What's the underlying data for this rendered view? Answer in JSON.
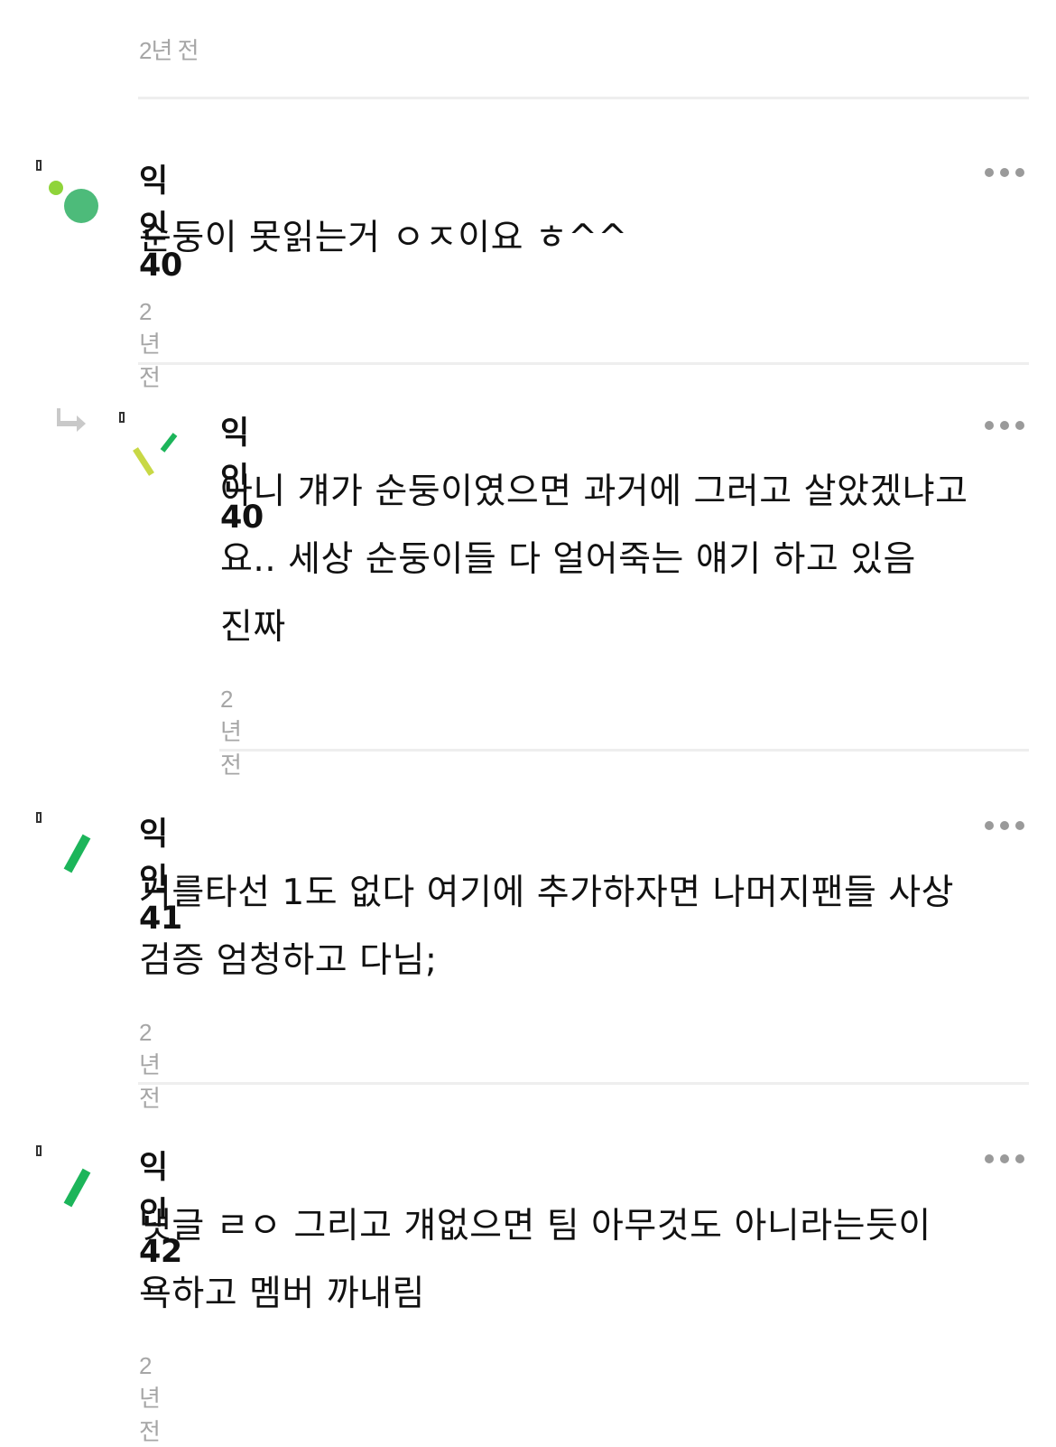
{
  "top": {
    "timestamp": "2년 전"
  },
  "comments": [
    {
      "author": "익인40",
      "text": "순둥이 못읽는거 ㅇㅈ이요 ㅎ^^",
      "timestamp": "2년 전",
      "avatar": "two-green-dots"
    },
    {
      "author": "익인40",
      "text": "아니 걔가 순둥이였으면 과거에 그러고 살았겠냐고요.. 세상 순둥이들 다 얼어죽는 얘기 하고 있음 진짜",
      "lines": [
        "아니 걔가 순둥이였으면 과거에 그러고 살았겠냐고",
        "요.. 세상 순둥이들 다 얼어죽는 얘기 하고 있음",
        "진짜"
      ],
      "timestamp": "2년 전",
      "is_reply": true,
      "avatar": "green-yellow-strokes"
    },
    {
      "author": "익인41",
      "text": "거를타선 1도 없다 여기에 추가하자면 나머지팬들 사상검증 엄청하고 다님;",
      "lines": [
        "거를타선 1도 없다 여기에 추가하자면 나머지팬들 사상",
        "검증 엄청하고 다님;"
      ],
      "timestamp": "2년 전",
      "avatar": "green-stroke"
    },
    {
      "author": "익인42",
      "text": "댓글 ㄹㅇ 그리고 걔없으면 팀 아무것도 아니라는듯이 욕하고 멤버 까내림",
      "lines": [
        "댓글 ㄹㅇ 그리고 걔없으면 팀 아무것도 아니라는듯이",
        "욕하고 멤버 까내림"
      ],
      "timestamp": "2년 전",
      "avatar": "green-stroke"
    }
  ],
  "icons": {
    "more": "more-dots-icon",
    "reply": "reply-arrow-icon"
  },
  "colors": {
    "divider": "#eeeeee",
    "timestamp": "#a6a6a6",
    "dots": "#9a9a9a",
    "avatar_green": "#4dbb7a",
    "avatar_lime": "#8fd43a",
    "avatar_stroke_green": "#1cb55a",
    "avatar_stroke_yellow": "#c8d845"
  }
}
